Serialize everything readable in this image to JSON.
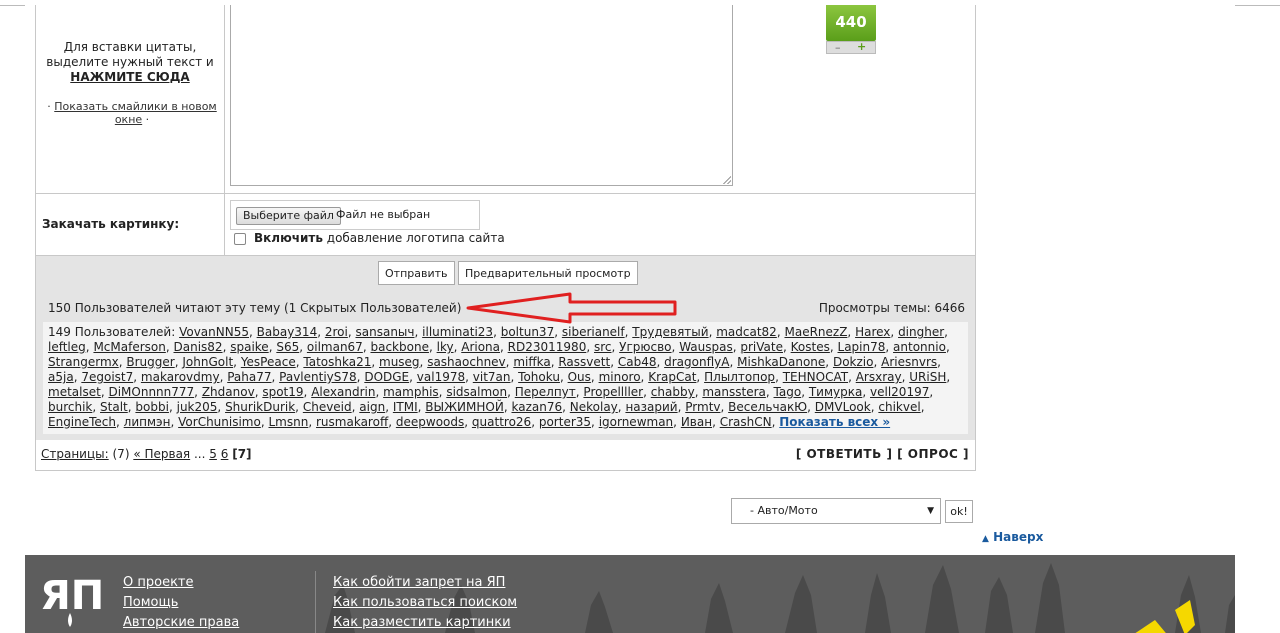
{
  "editor": {
    "quote_hint_line1": "Для вставки цитаты,",
    "quote_hint_line2": "выделите нужный текст и",
    "quote_hint_action": "НАЖМИТЕ СЮДА",
    "smiles_bullet_pre": "·",
    "smiles_link": "Показать смайлики в новом окне",
    "smiles_bullet_post": "·",
    "karma_value": "440",
    "karma_minus": "–",
    "karma_plus": "+"
  },
  "upload": {
    "label": "Закачать картинку:",
    "choose_button": "Выберите файл",
    "no_file": "Файл не выбран",
    "logo_bold": "Включить",
    "logo_text": "добавление логотипа сайта"
  },
  "submit": {
    "send_button": "Отправить",
    "preview_button": "Предварительный просмотр"
  },
  "readers": {
    "header": "150 Пользователей читают эту тему (1 Скрытых Пользователей)",
    "views": "Просмотры темы: 6466",
    "users_prefix": "149 Пользователей:",
    "users": [
      "VovanNN55",
      "Babay314",
      "2roi",
      "sansanыч",
      "illuminati23",
      "boltun37",
      "siberianelf",
      "Трудевятый",
      "madcat82",
      "MaeRnezZ",
      "Harex",
      "dingher",
      "leftleg",
      "McMaferson",
      "Danis82",
      "spaike",
      "S65",
      "oilman67",
      "backbone",
      "lky",
      "Ariona",
      "RD23011980",
      "src",
      "Угрюсво",
      "Wauspas",
      "priVate",
      "Kostes",
      "Lapin78",
      "antonnio",
      "Strangermx",
      "Brugger",
      "JohnGolt",
      "YesPeace",
      "Tatoshka21",
      "museg",
      "sashaochnev",
      "miffka",
      "Rassvett",
      "Cab48",
      "dragonflyA",
      "MishkaDanone",
      "Dokzio",
      "Ariesnvrs",
      "a5ja",
      "7egoist7",
      "makarovdmy",
      "Paha77",
      "PavlentiyS78",
      "DODGE",
      "val1978",
      "vit7an",
      "Tohoku",
      "Ous",
      "minoro",
      "KrapCat",
      "Плылтопор",
      "TEHNOCAT",
      "Arsxray",
      "URiSH",
      "metalset",
      "DiMOnnnn777",
      "Zhdanov",
      "spot19",
      "Alexandrin",
      "mamphis",
      "sidsalmon",
      "Перелпут",
      "Propellller",
      "chabby",
      "mansstera",
      "Tago",
      "Тимурка",
      "vell20197",
      "burchik",
      "Stalt",
      "bobbi",
      "juk205",
      "ShurikDurik",
      "Cheveid",
      "aign",
      "ITMI",
      "ВЫЖИМНОЙ",
      "kazan76",
      "Nekolay",
      "назарий",
      "Prmtv",
      "ВесельчакЮ",
      "DMVLook",
      "chikvel",
      "EngineTech",
      "липмэн",
      "VorChunisimo",
      "Lmsnn",
      "rusmakaroff",
      "deepwoods",
      "quattro26",
      "porter35",
      "igornewman",
      "Иван",
      "CrashCN"
    ],
    "show_all": "Показать всех »"
  },
  "pager": {
    "label": "Страницы:",
    "count": "(7)",
    "first": "« Первая",
    "ellipsis": "...",
    "p5": "5",
    "p6": "6",
    "current": "[7]",
    "reply": "[ ОТВЕТИТЬ ]",
    "poll": "[ ОПРОС ]"
  },
  "jump": {
    "selected": "- Авто/Мото",
    "ok": "ok!",
    "to_top": "Наверх"
  },
  "footer": {
    "logo": "ЯП",
    "col1": [
      "О проекте",
      "Помощь",
      "Авторские права"
    ],
    "col2": [
      "Как обойти запрет на ЯП",
      "Как пользоваться поиском",
      "Как разместить картинки"
    ]
  },
  "colors": {
    "karma_green": "#6cb22a",
    "annotation_red": "#e02020",
    "footer_bg": "#5d5d5d",
    "link_blue": "#1a5a9e"
  }
}
